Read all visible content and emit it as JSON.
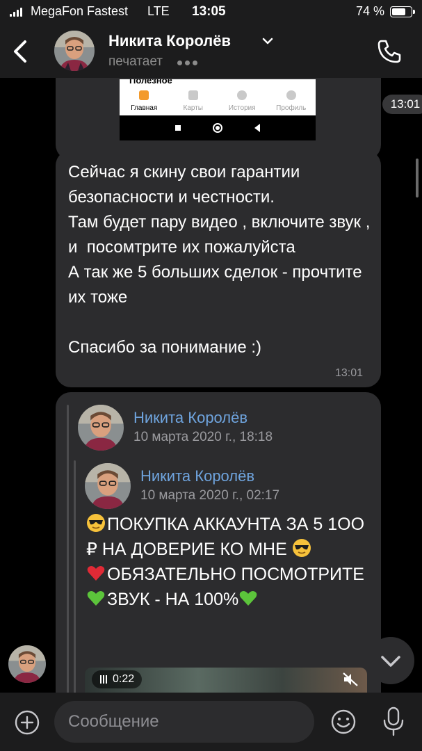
{
  "status_bar": {
    "carrier": "MegaFon Fastest",
    "network": "LTE",
    "time": "13:05",
    "battery": "74 %",
    "battery_level": 0.74
  },
  "header": {
    "contact_name": "Никита Королёв",
    "status": "печатает",
    "icons": [
      "chevron-left-icon",
      "chevron-down-icon",
      "phone-icon"
    ]
  },
  "messages": {
    "image_message": {
      "screenshot_title": "Полезное",
      "tabs": [
        "Главная",
        "Карты",
        "История",
        "Профиль"
      ],
      "time": "13:01"
    },
    "text_message": {
      "text": "Сейчас я скину свои гарантии безопасности и честности.\nТам будет пару видео , включите звук , и  посомтрите их пожалуйста\nА так же 5 больших сделок - прочтите их тоже\n\nСпасибо за понимание :)",
      "time": "13:01"
    },
    "forwarded_message": {
      "outer_name": "Никита Королёв",
      "outer_date": "10 марта 2020 г., 18:18",
      "inner_name": "Никита Королёв",
      "inner_date": "10 марта 2020 г., 02:17",
      "line1": "ПОКУПКА АККАУНТА ЗА 5 1ОО ₽ НА ДОВЕРИЕ КО МНЕ",
      "line2": "ОБЯЗАТЕЛЬНО ПОСМОТРИТЕ",
      "line3": "ЗВУК - НА 100%",
      "video_duration": "0:22"
    }
  },
  "input": {
    "placeholder": "Сообщение"
  },
  "colors": {
    "background": "#000000",
    "bar": "#1c1c1d",
    "bubble": "#2c2c2e",
    "link": "#6fa4de"
  }
}
